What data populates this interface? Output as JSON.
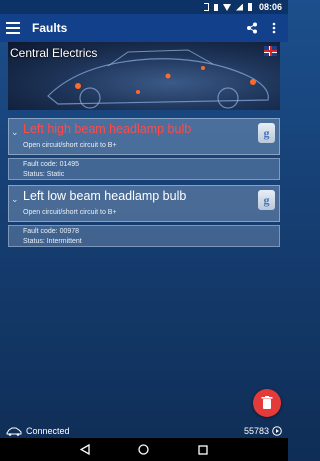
{
  "status_bar": {
    "time": "08:06",
    "icons": [
      "bluetooth-icon",
      "vibrate-icon",
      "wifi-icon",
      "cellular-icon",
      "battery-icon"
    ]
  },
  "app_bar": {
    "title": "Faults",
    "menu_icon": "hamburger-menu-icon",
    "actions": [
      "share-icon",
      "overflow-menu-icon"
    ]
  },
  "banner": {
    "title": "Central Electrics",
    "language_icon": "uk-flag-icon"
  },
  "faults": [
    {
      "name": "Left high beam headlamp bulb",
      "name_color": "#ff4a4a",
      "description": "Open circuit/short circuit to B+",
      "search_icon": "google-search-icon",
      "details": [
        "Fault code: 01495",
        "Status: Static"
      ]
    },
    {
      "name": "Left low beam headlamp bulb",
      "name_color": "#ffffff",
      "description": "Open circuit/short circuit to B+",
      "search_icon": "google-search-icon",
      "details": [
        "Fault code: 00978",
        "Status: Intermittent"
      ]
    }
  ],
  "fab": {
    "icon": "delete-icon",
    "color": "#e53a3a"
  },
  "bottom_status": {
    "connection_icon": "car-icon",
    "connection_text": "Connected",
    "counter": "55783",
    "counter_icon": "play-circle-icon"
  },
  "nav_bar": {
    "buttons": [
      "back-icon",
      "home-icon",
      "recents-icon"
    ]
  }
}
